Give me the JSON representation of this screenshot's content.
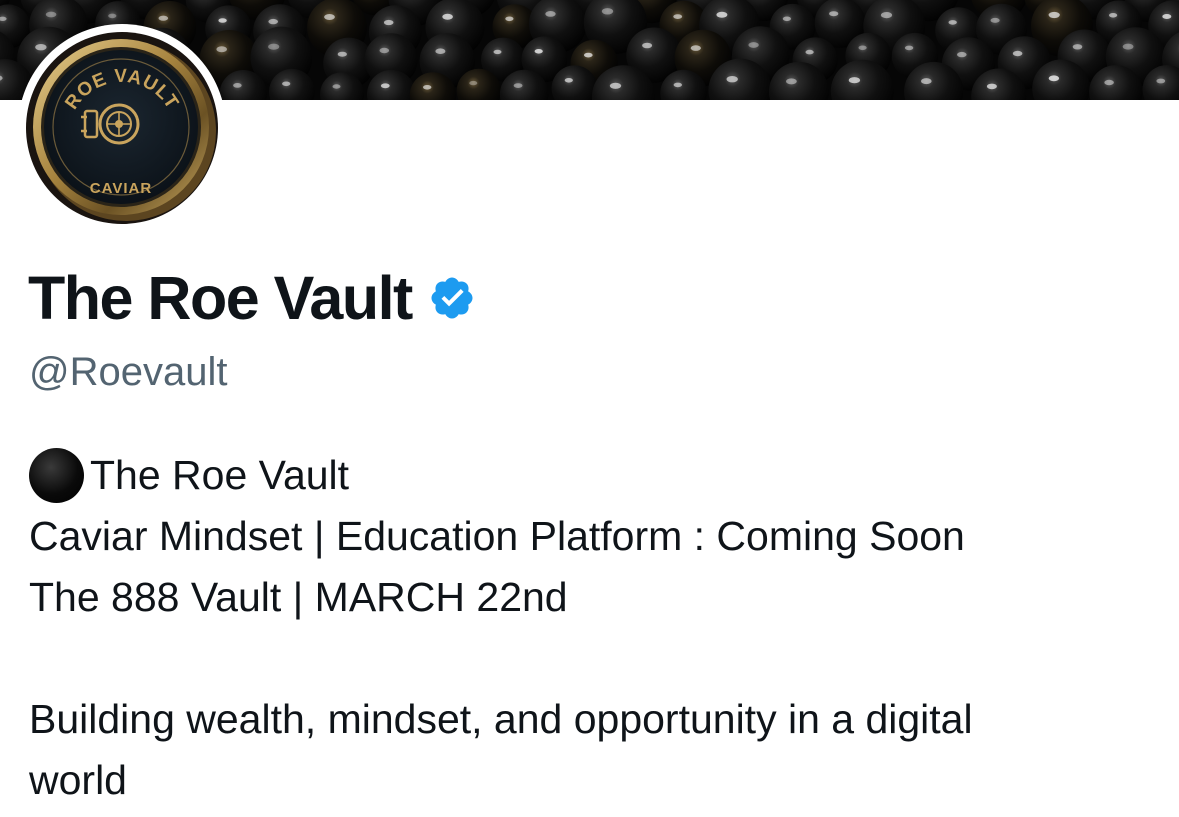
{
  "banner": {
    "icon": "caviar-pearls-banner"
  },
  "avatar": {
    "top_text": "ROE VAULT",
    "bottom_text": "CAVIAR",
    "icon": "vault-door-icon",
    "colors": {
      "tin": "#101820",
      "gold": "#b8975a"
    }
  },
  "profile": {
    "display_name": "The Roe Vault",
    "verified_icon": "verified-badge-icon",
    "verified_color": "#1d9bf0",
    "handle": "@Roevault"
  },
  "bio": {
    "line1_emoji": "black-circle-icon",
    "line1_text": "The Roe Vault",
    "line2": "Caviar Mindset | Education Platform : Coming Soon",
    "line3": "The 888 Vault | MARCH 22nd",
    "line4": "Building wealth, mindset, and opportunity in a digital",
    "line5": "world"
  }
}
